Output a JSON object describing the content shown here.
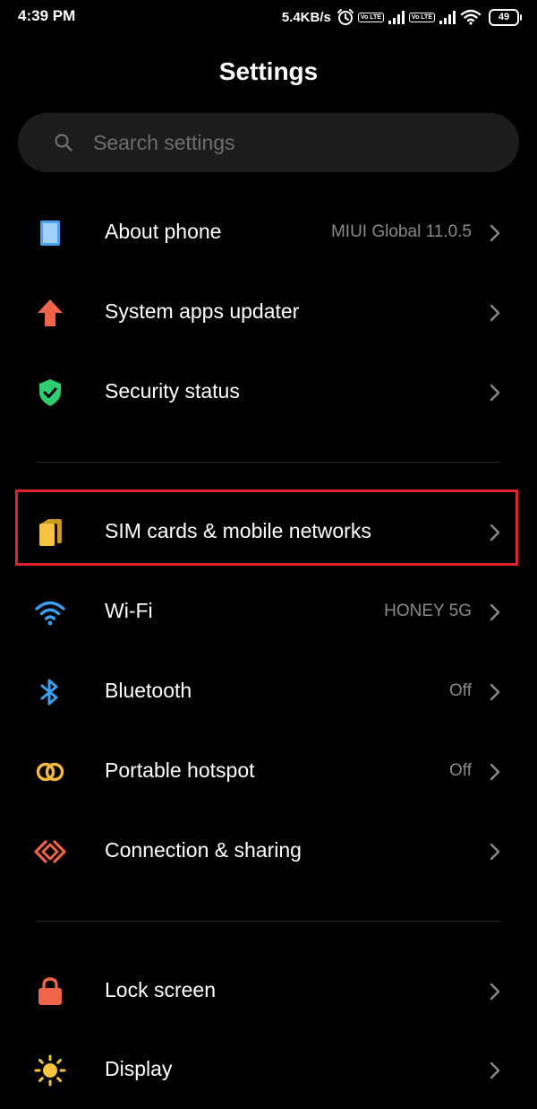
{
  "status_bar": {
    "time": "4:39 PM",
    "net_speed": "5.4KB/s",
    "volte_1": "Vo LTE",
    "volte_2": "Vo LTE",
    "battery": "49"
  },
  "header": {
    "title": "Settings"
  },
  "search": {
    "placeholder": "Search settings",
    "value": ""
  },
  "items": [
    {
      "label": "About phone",
      "value": "MIUI Global 11.0.5",
      "icon": "phone-icon",
      "icon_color": "#4aa3f0"
    },
    {
      "label": "System apps updater",
      "value": "",
      "icon": "arrow-up-icon",
      "icon_color": "#f0654a"
    },
    {
      "label": "Security status",
      "value": "",
      "icon": "shield-check-icon",
      "icon_color": "#2fcc71"
    },
    {
      "label": "SIM cards & mobile networks",
      "value": "",
      "icon": "sim-card-icon",
      "icon_color": "#f5c542"
    },
    {
      "label": "Wi-Fi",
      "value": "HONEY 5G",
      "icon": "wifi-icon",
      "icon_color": "#3aa0f0"
    },
    {
      "label": "Bluetooth",
      "value": "Off",
      "icon": "bluetooth-icon",
      "icon_color": "#3aa0f0"
    },
    {
      "label": "Portable hotspot",
      "value": "Off",
      "icon": "hotspot-icon",
      "icon_color": "#f5b942"
    },
    {
      "label": "Connection & sharing",
      "value": "",
      "icon": "connection-sharing-icon",
      "icon_color": "#f0654a"
    },
    {
      "label": "Lock screen",
      "value": "",
      "icon": "lock-icon",
      "icon_color": "#f0654a"
    },
    {
      "label": "Display",
      "value": "",
      "icon": "sun-icon",
      "icon_color": "#f5c542"
    }
  ],
  "colors": {
    "background": "#000000",
    "highlight": "#e0232f",
    "secondary_text": "#8a8a8a"
  }
}
